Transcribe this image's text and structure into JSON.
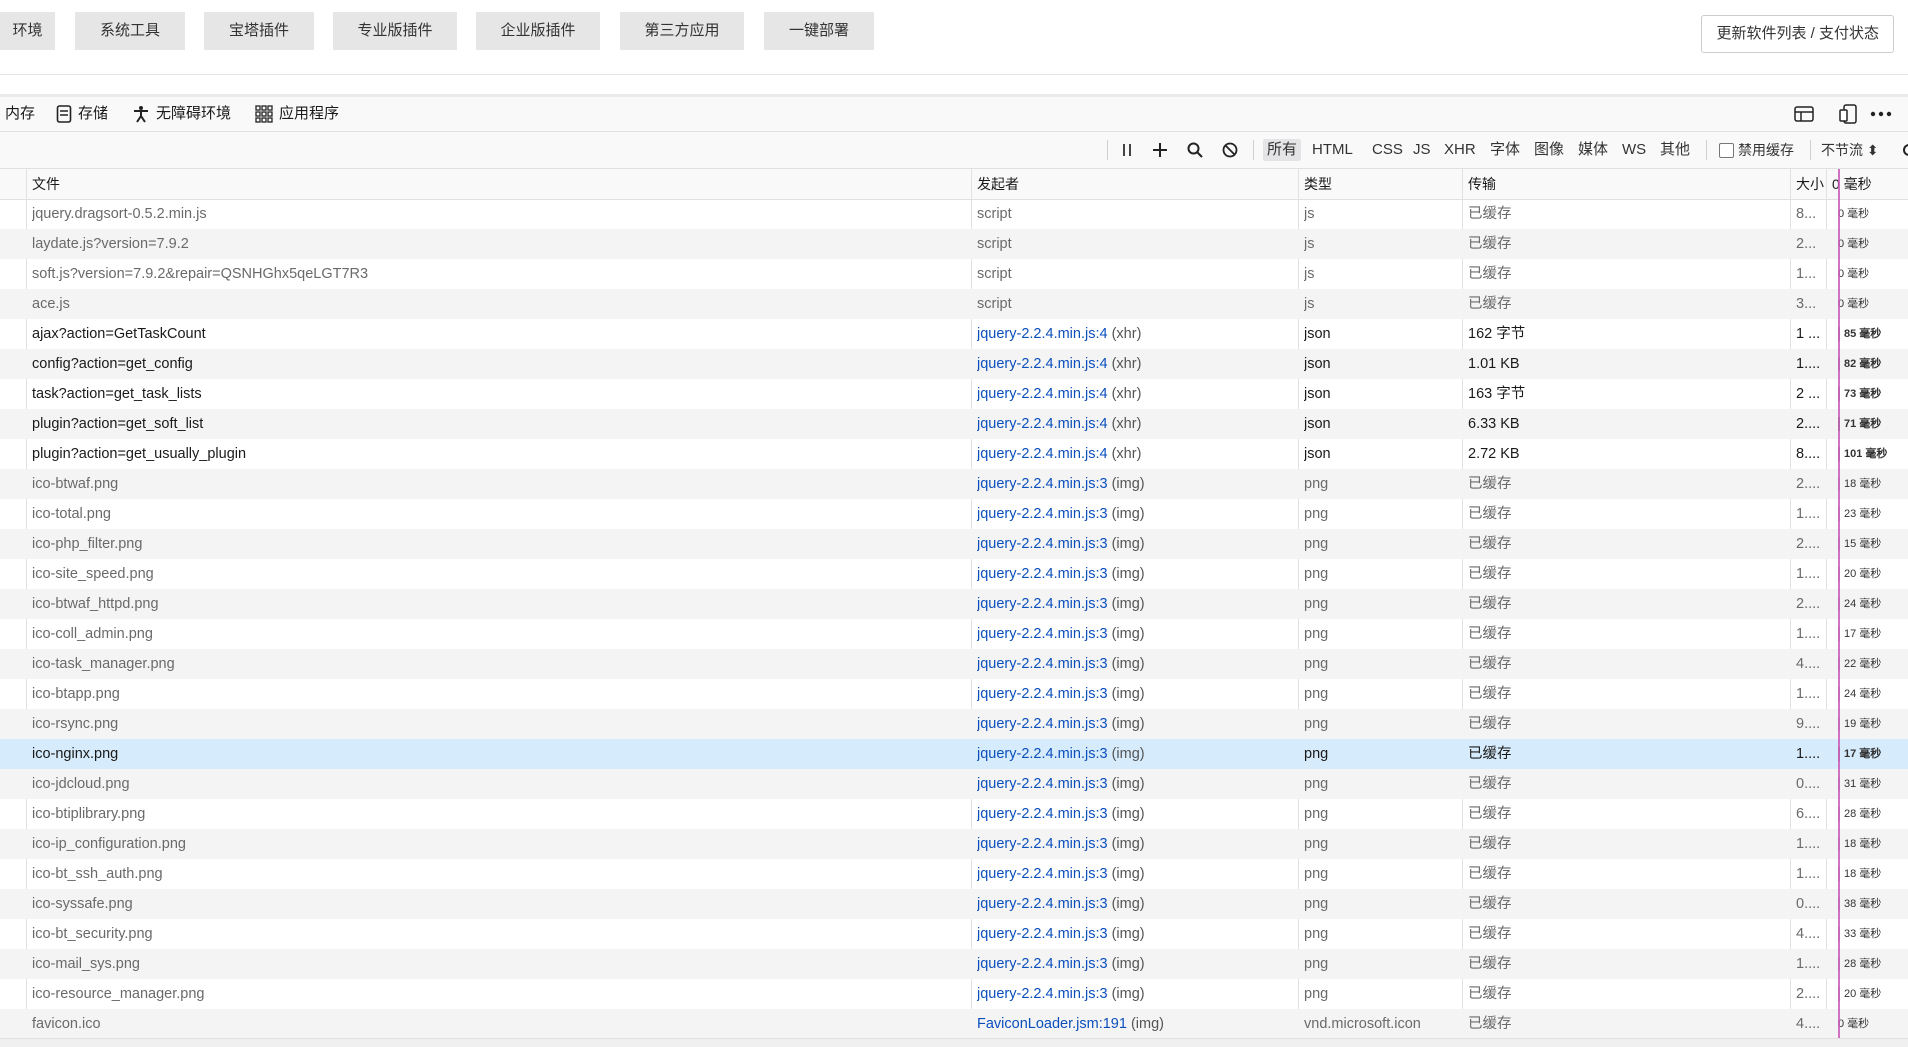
{
  "topbar": {
    "tabs": [
      "环境",
      "系统工具",
      "宝塔插件",
      "专业版插件",
      "企业版插件",
      "第三方应用",
      "一键部署"
    ],
    "update_button": "更新软件列表 / 支付状态"
  },
  "devtools": {
    "tabs": {
      "memory": "内存",
      "storage": "存储",
      "accessibility": "无障碍环境",
      "application": "应用程序"
    }
  },
  "filters": {
    "types": [
      "所有",
      "HTML",
      "CSS",
      "JS",
      "XHR",
      "字体",
      "图像",
      "媒体",
      "WS",
      "其他"
    ],
    "selected": "所有",
    "disable_cache": "禁用缓存",
    "throttle": "不节流 ⬍"
  },
  "table": {
    "headers": {
      "file": "文件",
      "initiator": "发起者",
      "type": "类型",
      "transferred": "传输",
      "size": "大小",
      "time": "0 毫秒"
    },
    "rows": [
      {
        "file": "jquery.dragsort-0.5.2.min.js",
        "init": "",
        "init_text": "script",
        "type": "js",
        "trans": "已缓存",
        "size": "8...",
        "time": "0 毫秒",
        "cached": true,
        "bar": "none"
      },
      {
        "file": "laydate.js?version=7.9.2",
        "init": "",
        "init_text": "script",
        "type": "js",
        "trans": "已缓存",
        "size": "2...",
        "time": "0 毫秒",
        "cached": true,
        "bar": "none"
      },
      {
        "file": "soft.js?version=7.9.2&repair=QSNHGhx5qeLGT7R3",
        "init": "",
        "init_text": "script",
        "type": "js",
        "trans": "已缓存",
        "size": "1...",
        "time": "0 毫秒",
        "cached": true,
        "bar": "none"
      },
      {
        "file": "ace.js",
        "init": "",
        "init_text": "script",
        "type": "js",
        "trans": "已缓存",
        "size": "3...",
        "time": "0 毫秒",
        "cached": true,
        "bar": "none"
      },
      {
        "file": "ajax?action=GetTaskCount",
        "init": "jquery-2.2.4.min.js:4",
        "init_text": "(xhr)",
        "type": "json",
        "trans": "162 字节",
        "size": "1 ...",
        "time": "85 毫秒",
        "cached": false,
        "bar": "gray"
      },
      {
        "file": "config?action=get_config",
        "init": "jquery-2.2.4.min.js:4",
        "init_text": "(xhr)",
        "type": "json",
        "trans": "1.01 KB",
        "size": "1....",
        "time": "82 毫秒",
        "cached": false,
        "bar": "gray"
      },
      {
        "file": "task?action=get_task_lists",
        "init": "jquery-2.2.4.min.js:4",
        "init_text": "(xhr)",
        "type": "json",
        "trans": "163 字节",
        "size": "2 ...",
        "time": "73 毫秒",
        "cached": false,
        "bar": "gray"
      },
      {
        "file": "plugin?action=get_soft_list",
        "init": "jquery-2.2.4.min.js:4",
        "init_text": "(xhr)",
        "type": "json",
        "trans": "6.33 KB",
        "size": "2....",
        "time": "71 毫秒",
        "cached": false,
        "bar": "green"
      },
      {
        "file": "plugin?action=get_usually_plugin",
        "init": "jquery-2.2.4.min.js:4",
        "init_text": "(xhr)",
        "type": "json",
        "trans": "2.72 KB",
        "size": "8....",
        "time": "101 毫秒",
        "cached": false,
        "bar": "gray"
      },
      {
        "file": "ico-btwaf.png",
        "init": "jquery-2.2.4.min.js:3",
        "init_text": "(img)",
        "type": "png",
        "trans": "已缓存",
        "size": "2....",
        "time": "18 毫秒",
        "cached": true,
        "bar": "light"
      },
      {
        "file": "ico-total.png",
        "init": "jquery-2.2.4.min.js:3",
        "init_text": "(img)",
        "type": "png",
        "trans": "已缓存",
        "size": "1....",
        "time": "23 毫秒",
        "cached": true,
        "bar": "light"
      },
      {
        "file": "ico-php_filter.png",
        "init": "jquery-2.2.4.min.js:3",
        "init_text": "(img)",
        "type": "png",
        "trans": "已缓存",
        "size": "2....",
        "time": "15 毫秒",
        "cached": true,
        "bar": "light"
      },
      {
        "file": "ico-site_speed.png",
        "init": "jquery-2.2.4.min.js:3",
        "init_text": "(img)",
        "type": "png",
        "trans": "已缓存",
        "size": "1....",
        "time": "20 毫秒",
        "cached": true,
        "bar": "light"
      },
      {
        "file": "ico-btwaf_httpd.png",
        "init": "jquery-2.2.4.min.js:3",
        "init_text": "(img)",
        "type": "png",
        "trans": "已缓存",
        "size": "2....",
        "time": "24 毫秒",
        "cached": true,
        "bar": "light"
      },
      {
        "file": "ico-coll_admin.png",
        "init": "jquery-2.2.4.min.js:3",
        "init_text": "(img)",
        "type": "png",
        "trans": "已缓存",
        "size": "1....",
        "time": "17 毫秒",
        "cached": true,
        "bar": "light"
      },
      {
        "file": "ico-task_manager.png",
        "init": "jquery-2.2.4.min.js:3",
        "init_text": "(img)",
        "type": "png",
        "trans": "已缓存",
        "size": "4....",
        "time": "22 毫秒",
        "cached": true,
        "bar": "light"
      },
      {
        "file": "ico-btapp.png",
        "init": "jquery-2.2.4.min.js:3",
        "init_text": "(img)",
        "type": "png",
        "trans": "已缓存",
        "size": "1....",
        "time": "24 毫秒",
        "cached": true,
        "bar": "light"
      },
      {
        "file": "ico-rsync.png",
        "init": "jquery-2.2.4.min.js:3",
        "init_text": "(img)",
        "type": "png",
        "trans": "已缓存",
        "size": "9....",
        "time": "19 毫秒",
        "cached": true,
        "bar": "light"
      },
      {
        "file": "ico-nginx.png",
        "init": "jquery-2.2.4.min.js:3",
        "init_text": "(img)",
        "type": "png",
        "trans": "已缓存",
        "size": "1....",
        "time": "17 毫秒",
        "cached": false,
        "selected": true,
        "bar": "gray"
      },
      {
        "file": "ico-jdcloud.png",
        "init": "jquery-2.2.4.min.js:3",
        "init_text": "(img)",
        "type": "png",
        "trans": "已缓存",
        "size": "0....",
        "time": "31 毫秒",
        "cached": true,
        "bar": "light"
      },
      {
        "file": "ico-btiplibrary.png",
        "init": "jquery-2.2.4.min.js:3",
        "init_text": "(img)",
        "type": "png",
        "trans": "已缓存",
        "size": "6....",
        "time": "28 毫秒",
        "cached": true,
        "bar": "light"
      },
      {
        "file": "ico-ip_configuration.png",
        "init": "jquery-2.2.4.min.js:3",
        "init_text": "(img)",
        "type": "png",
        "trans": "已缓存",
        "size": "1....",
        "time": "18 毫秒",
        "cached": true,
        "bar": "light"
      },
      {
        "file": "ico-bt_ssh_auth.png",
        "init": "jquery-2.2.4.min.js:3",
        "init_text": "(img)",
        "type": "png",
        "trans": "已缓存",
        "size": "1....",
        "time": "18 毫秒",
        "cached": true,
        "bar": "light"
      },
      {
        "file": "ico-syssafe.png",
        "init": "jquery-2.2.4.min.js:3",
        "init_text": "(img)",
        "type": "png",
        "trans": "已缓存",
        "size": "0....",
        "time": "38 毫秒",
        "cached": true,
        "bar": "light"
      },
      {
        "file": "ico-bt_security.png",
        "init": "jquery-2.2.4.min.js:3",
        "init_text": "(img)",
        "type": "png",
        "trans": "已缓存",
        "size": "4....",
        "time": "33 毫秒",
        "cached": true,
        "bar": "light"
      },
      {
        "file": "ico-mail_sys.png",
        "init": "jquery-2.2.4.min.js:3",
        "init_text": "(img)",
        "type": "png",
        "trans": "已缓存",
        "size": "1....",
        "time": "28 毫秒",
        "cached": true,
        "bar": "light"
      },
      {
        "file": "ico-resource_manager.png",
        "init": "jquery-2.2.4.min.js:3",
        "init_text": "(img)",
        "type": "png",
        "trans": "已缓存",
        "size": "2....",
        "time": "20 毫秒",
        "cached": true,
        "bar": "light"
      },
      {
        "file": "favicon.ico",
        "init": "FaviconLoader.jsm:191",
        "init_text": "(img)",
        "type": "vnd.microsoft.icon",
        "trans": "已缓存",
        "size": "4....",
        "time": "0 毫秒",
        "cached": true,
        "bar": "none"
      }
    ]
  }
}
